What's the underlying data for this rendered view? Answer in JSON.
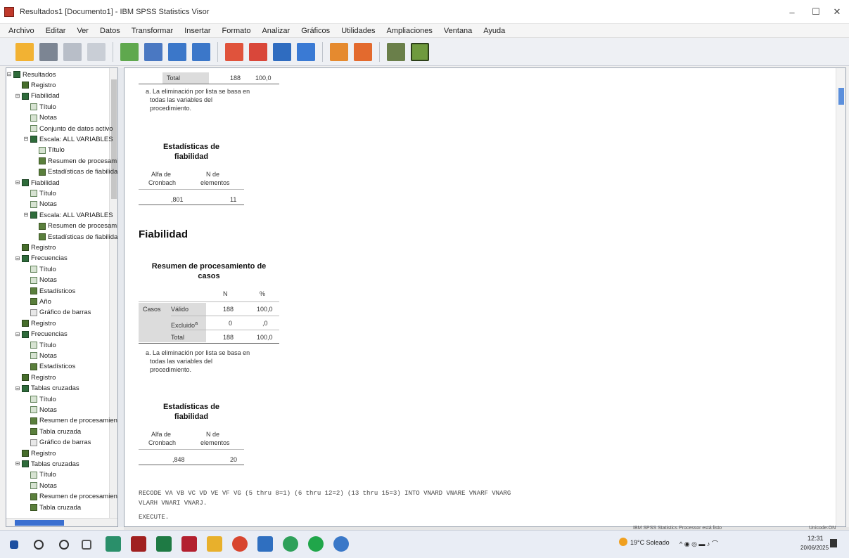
{
  "window": {
    "title": "Resultados1 [Documento1] - IBM SPSS Statistics Visor",
    "minimize": "–",
    "maximize": "☐",
    "close": "✕"
  },
  "menu": [
    "Archivo",
    "Editar",
    "Ver",
    "Datos",
    "Transformar",
    "Insertar",
    "Formato",
    "Analizar",
    "Gráficos",
    "Utilidades",
    "Ampliaciones",
    "Ventana",
    "Ayuda"
  ],
  "toolbar_icons": [
    "open-icon",
    "save-icon",
    "print-icon",
    "print-preview-icon",
    "export-icon",
    "recall-dialog-icon",
    "undo-icon",
    "redo-icon",
    "goto-data-icon",
    "goto-case-icon",
    "goto-variable-icon",
    "variables-icon",
    "insert-output-icon",
    "designate-window-icon",
    "select-icon",
    "run-icon"
  ],
  "outline": {
    "items": [
      {
        "label": "Resultados",
        "icon": "output-book-icon",
        "level": 0,
        "toggle": "⊟"
      },
      {
        "label": "Registro",
        "icon": "log-icon",
        "level": 1
      },
      {
        "label": "Fiabilidad",
        "icon": "output-book-icon",
        "level": 1,
        "toggle": "⊟"
      },
      {
        "label": "Título",
        "icon": "title-icon",
        "level": 2
      },
      {
        "label": "Notas",
        "icon": "notes-icon",
        "level": 2
      },
      {
        "label": "Conjunto de datos activo",
        "icon": "notes-icon",
        "level": 2
      },
      {
        "label": "Escala: ALL VARIABLES",
        "icon": "output-book-icon",
        "level": 2,
        "toggle": "⊟"
      },
      {
        "label": "Título",
        "icon": "title-icon",
        "level": 3
      },
      {
        "label": "Resumen de procesamiento de casos",
        "icon": "table-icon",
        "level": 3
      },
      {
        "label": "Estadísticas de fiabilidad",
        "icon": "table-icon",
        "level": 3
      },
      {
        "label": "Fiabilidad",
        "icon": "output-book-icon",
        "level": 1,
        "toggle": "⊟"
      },
      {
        "label": "Título",
        "icon": "title-icon",
        "level": 2
      },
      {
        "label": "Notas",
        "icon": "notes-icon",
        "level": 2
      },
      {
        "label": "Escala: ALL VARIABLES",
        "icon": "output-book-icon",
        "level": 2,
        "toggle": "⊟"
      },
      {
        "label": "Resumen de procesamiento de casos",
        "icon": "table-icon",
        "level": 3
      },
      {
        "label": "Estadísticas de fiabilidad",
        "icon": "table-icon",
        "level": 3
      },
      {
        "label": "Registro",
        "icon": "log-icon",
        "level": 1
      },
      {
        "label": "Frecuencias",
        "icon": "output-book-icon",
        "level": 1,
        "toggle": "⊟"
      },
      {
        "label": "Título",
        "icon": "title-icon",
        "level": 2
      },
      {
        "label": "Notas",
        "icon": "notes-icon",
        "level": 2
      },
      {
        "label": "Estadísticos",
        "icon": "table-icon",
        "level": 2
      },
      {
        "label": "Año",
        "icon": "table-icon",
        "level": 2
      },
      {
        "label": "Gráfico de barras",
        "icon": "chart-icon",
        "level": 2
      },
      {
        "label": "Registro",
        "icon": "log-icon",
        "level": 1
      },
      {
        "label": "Frecuencias",
        "icon": "output-book-icon",
        "level": 1,
        "toggle": "⊟"
      },
      {
        "label": "Título",
        "icon": "title-icon",
        "level": 2
      },
      {
        "label": "Notas",
        "icon": "notes-icon",
        "level": 2
      },
      {
        "label": "Estadísticos",
        "icon": "table-icon",
        "level": 2
      },
      {
        "label": "Registro",
        "icon": "log-icon",
        "level": 1
      },
      {
        "label": "Tablas cruzadas",
        "icon": "output-book-icon",
        "level": 1,
        "toggle": "⊟"
      },
      {
        "label": "Título",
        "icon": "title-icon",
        "level": 2
      },
      {
        "label": "Notas",
        "icon": "notes-icon",
        "level": 2
      },
      {
        "label": "Resumen de procesamiento de casos",
        "icon": "table-icon",
        "level": 2
      },
      {
        "label": "Tabla cruzada",
        "icon": "table-icon",
        "level": 2
      },
      {
        "label": "Gráfico de barras",
        "icon": "chart-icon",
        "level": 2
      },
      {
        "label": "Registro",
        "icon": "log-icon",
        "level": 1
      },
      {
        "label": "Tablas cruzadas",
        "icon": "output-book-icon",
        "level": 1,
        "toggle": "⊟"
      },
      {
        "label": "Título",
        "icon": "title-icon",
        "level": 2
      },
      {
        "label": "Notas",
        "icon": "notes-icon",
        "level": 2
      },
      {
        "label": "Resumen de procesamiento de casos",
        "icon": "table-icon",
        "level": 2
      },
      {
        "label": "Tabla cruzada",
        "icon": "table-icon",
        "level": 2
      }
    ]
  },
  "content": {
    "top_table": {
      "total_label": "Total",
      "n": "188",
      "pct": "100,0",
      "footnote": [
        "a. La eliminación por lista se basa en",
        "todas las variables del",
        "procedimiento."
      ]
    },
    "reliability1": {
      "title_line1": "Estadísticas de",
      "title_line2": "fiabilidad",
      "col1_line1": "Alfa de",
      "col1_line2": "Cronbach",
      "col2_line1": "N de",
      "col2_line2": "elementos",
      "alpha": ",801",
      "n_items": "11"
    },
    "section_heading": "Fiabilidad",
    "case_summary": {
      "title_line1": "Resumen de procesamiento de",
      "title_line2": "casos",
      "col_n": "N",
      "col_pct": "%",
      "group_label": "Casos",
      "rows": [
        {
          "label": "Válido",
          "n": "188",
          "pct": "100,0"
        },
        {
          "label": "Excluido",
          "sup": "a",
          "n": "0",
          "pct": ",0"
        },
        {
          "label": "Total",
          "n": "188",
          "pct": "100,0"
        }
      ],
      "footnote": [
        "a. La eliminación por lista se basa en",
        "todas las variables del",
        "procedimiento."
      ]
    },
    "reliability2": {
      "title_line1": "Estadísticas de",
      "title_line2": "fiabilidad",
      "col1_line1": "Alfa de",
      "col1_line2": "Cronbach",
      "col2_line1": "N de",
      "col2_line2": "elementos",
      "alpha": ",848",
      "n_items": "20"
    },
    "syntax": [
      "RECODE VA VB VC VD VE VF VG (5 thru 8=1) (6 thru 12=2) (13 thru 15=3) INTO VNARD VNARE VNARF VNARG",
      "    VLARH VNARI VNARJ.",
      "EXECUTE."
    ]
  },
  "status_bar": {
    "processor": "IBM SPSS Statistics Processor está listo",
    "unicode": "Unicode:ON"
  },
  "taskbar": {
    "apps": [
      "start-icon",
      "search-icon",
      "task-view-icon",
      "widgets-icon",
      "edge-icon",
      "access-icon",
      "excel-icon",
      "spss-icon",
      "file-explorer-icon",
      "chrome-icon",
      "store-icon",
      "teams-icon",
      "whatsapp-icon",
      "spss-viewer-icon"
    ],
    "weather": "19°C Soleado",
    "time": "12:31",
    "date": "20/06/2025"
  },
  "colors": {
    "accent": "#3a6fd0",
    "table_shade": "#dcdcdc"
  }
}
